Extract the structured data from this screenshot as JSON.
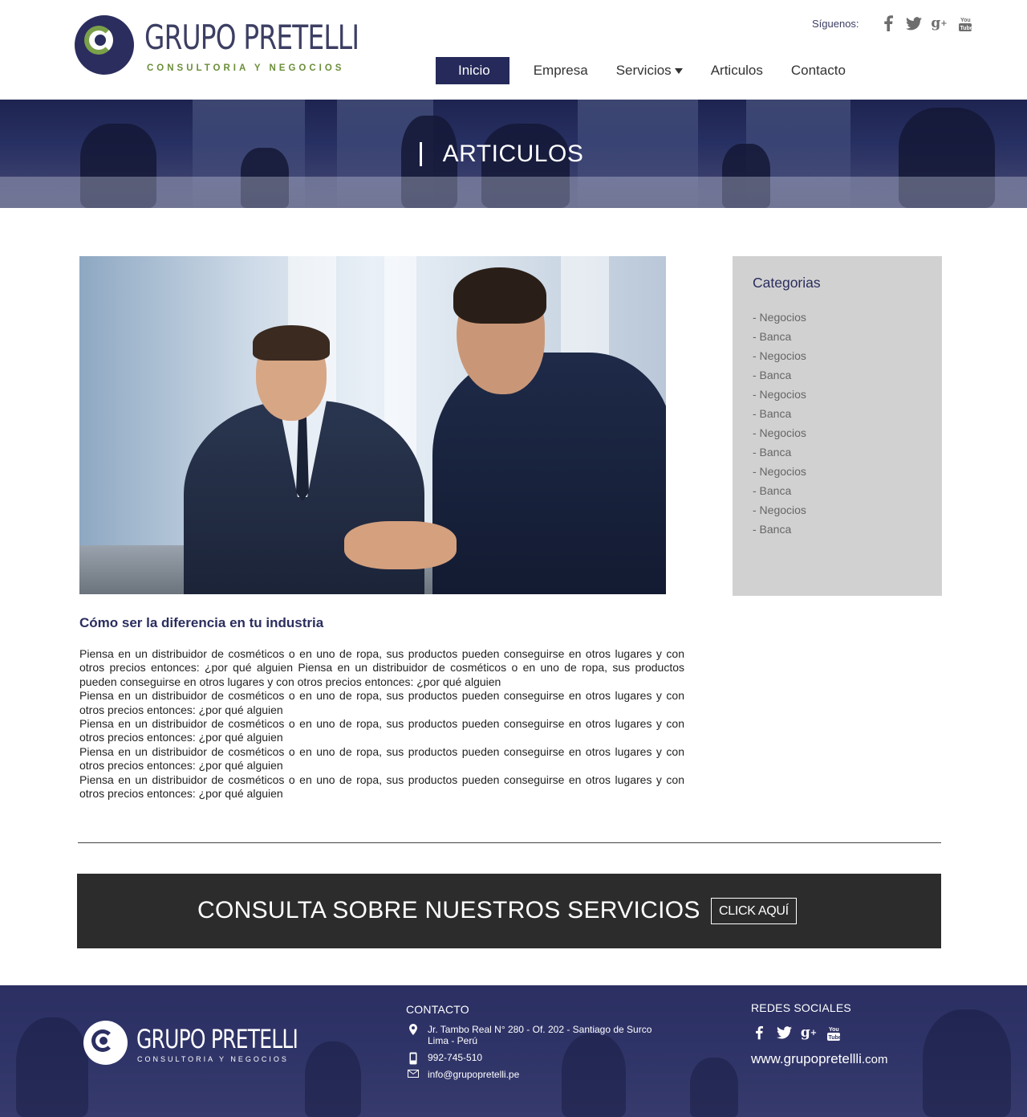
{
  "brand": {
    "name": "GRUPO PRETELLI",
    "tagline": "CONSULTORIA Y NEGOCIOS",
    "accent": "#262a5a",
    "green": "#7ba04a"
  },
  "header": {
    "social_label": "Síguenos:",
    "social_icons": [
      "facebook-icon",
      "twitter-icon",
      "google-plus-icon",
      "youtube-icon"
    ]
  },
  "nav": {
    "items": [
      {
        "label": "Inicio",
        "active": true
      },
      {
        "label": "Empresa"
      },
      {
        "label": "Servicios",
        "dropdown": true
      },
      {
        "label": "Articulos"
      },
      {
        "label": "Contacto"
      }
    ]
  },
  "banner": {
    "title": "ARTICULOS"
  },
  "article": {
    "title": "Cómo ser la diferencia en tu industria",
    "paragraphs": [
      "Piensa en un distribuidor de cosméticos o en uno de ropa, sus productos pueden conseguirse en otros lugares y con otros precios entonces: ¿por qué alguien Piensa en un distribuidor de cosméticos o en uno de ropa, sus productos pueden conseguirse en otros lugares y con otros precios entonces: ¿por qué alguien",
      "Piensa en un distribuidor de cosméticos o en uno de ropa, sus productos pueden conseguirse en otros lugares y con otros precios entonces: ¿por qué alguien",
      "Piensa en un distribuidor de cosméticos o en uno de ropa, sus productos pueden conseguirse en otros lugares y con otros precios entonces: ¿por qué alguien",
      "Piensa en un distribuidor de cosméticos o en uno de ropa, sus productos pueden conseguirse en otros lugares y con otros precios entonces: ¿por qué alguien",
      "Piensa en un distribuidor de cosméticos o en uno de ropa, sus productos pueden conseguirse en otros lugares y con otros precios entonces: ¿por qué alguien"
    ]
  },
  "sidebar": {
    "title": "Categorias",
    "categories": [
      "- Negocios",
      "- Banca",
      "- Negocios",
      "- Banca",
      "- Negocios",
      "- Banca",
      "- Negocios",
      "- Banca",
      "- Negocios",
      "- Banca",
      "- Negocios",
      "- Banca"
    ]
  },
  "cta": {
    "text": "CONSULTA SOBRE NUESTROS SERVICIOS",
    "button": "CLICK AQUÍ"
  },
  "footer": {
    "contact_title": "CONTACTO",
    "address_line1": "Jr. Tambo Real N° 280 - Of. 202 - Santiago de Surco",
    "address_line2": "Lima - Perú",
    "phone": "992-745-510",
    "email": "info@grupopretelli.pe",
    "social_title": "REDES SOCIALES",
    "website_main": "www.grupopretellli",
    "website_tld": ".com"
  }
}
